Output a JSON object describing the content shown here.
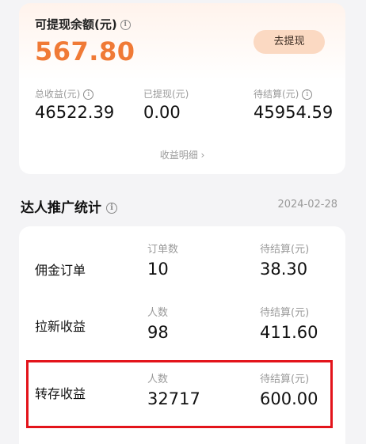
{
  "balance": {
    "label": "可提现余额(元)",
    "value": "567.80",
    "withdraw_button": "去提现",
    "accent_color": "#f07a36"
  },
  "stats": [
    {
      "label": "总收益(元)",
      "value": "46522.39",
      "has_info": true
    },
    {
      "label": "已提现(元)",
      "value": "0.00",
      "has_info": false
    },
    {
      "label": "待结算(元)",
      "value": "45954.59",
      "has_info": true
    }
  ],
  "detail_link": "收益明细 ›",
  "promo": {
    "title": "达人推广统计",
    "date": "2024-02-28",
    "rows": [
      {
        "title": "佣金订单",
        "col1_label": "订单数",
        "col1_value": "10",
        "col2_label": "待结算(元)",
        "col2_value": "38.30"
      },
      {
        "title": "拉新收益",
        "col1_label": "人数",
        "col1_value": "98",
        "col2_label": "待结算(元)",
        "col2_value": "411.60"
      },
      {
        "title": "转存收益",
        "col1_label": "人数",
        "col1_value": "32717",
        "col2_label": "待结算(元)",
        "col2_value": "600.00"
      }
    ]
  },
  "highlight_color": "#e3141b"
}
